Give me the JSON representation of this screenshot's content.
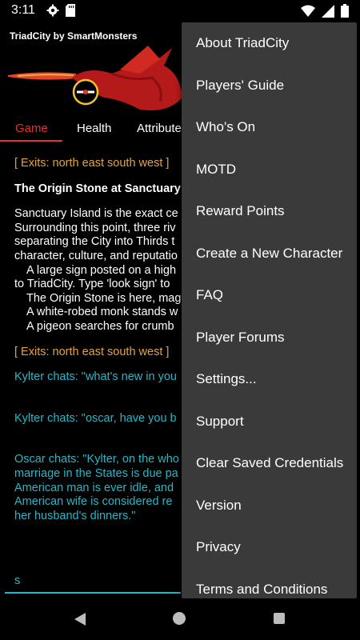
{
  "status_bar": {
    "time": "3:11",
    "icons": [
      "gear-icon",
      "sd-card-icon",
      "wifi-icon",
      "signal-icon",
      "battery-icon"
    ]
  },
  "header": {
    "app_title": "TriadCity by SmartMonsters"
  },
  "tabs": [
    {
      "label": "Game"
    },
    {
      "label": "Health"
    },
    {
      "label": "Attribute"
    }
  ],
  "game": {
    "exits_1": "[ Exits: north east south west ]",
    "room_title": "The Origin Stone at Sanctuary",
    "desc_lines": [
      "Sanctuary Island is the exact ce",
      "Surrounding this point, three riv",
      "separating the City into Thirds t",
      "character, culture, and reputatio"
    ],
    "sign_lines": [
      "A large sign posted on a high",
      "to TriadCity. Type 'look sign' to"
    ],
    "objects": [
      "The Origin Stone is here, mag",
      "A white-robed monk stands w",
      "A pigeon searches for crumb"
    ],
    "exits_2": "[ Exits: north east south west ]",
    "chat_1": "Kylter chats: \"what's new in you",
    "chat_2": "Kylter chats: \"oscar, have you b",
    "chat_3_lines": [
      "Oscar chats: \"Kylter, on the who",
      "marriage in the States is due pa",
      "American man is ever idle, and",
      "American wife is considered re",
      "her husband's dinners.\""
    ]
  },
  "input": {
    "value": "s"
  },
  "menu": {
    "items": [
      "About TriadCity",
      "Players' Guide",
      "Who's On",
      "MOTD",
      "Reward Points",
      "Create a New Character",
      "FAQ",
      "Player Forums",
      "Settings...",
      "Support",
      "Clear Saved Credentials",
      "Version",
      "Privacy",
      "Terms and Conditions"
    ]
  },
  "colors": {
    "accent_red": "#e0342c",
    "exit_orange": "#e8a23a",
    "chat_cyan": "#27b7c8",
    "menu_bg": "#3a3a3a"
  }
}
